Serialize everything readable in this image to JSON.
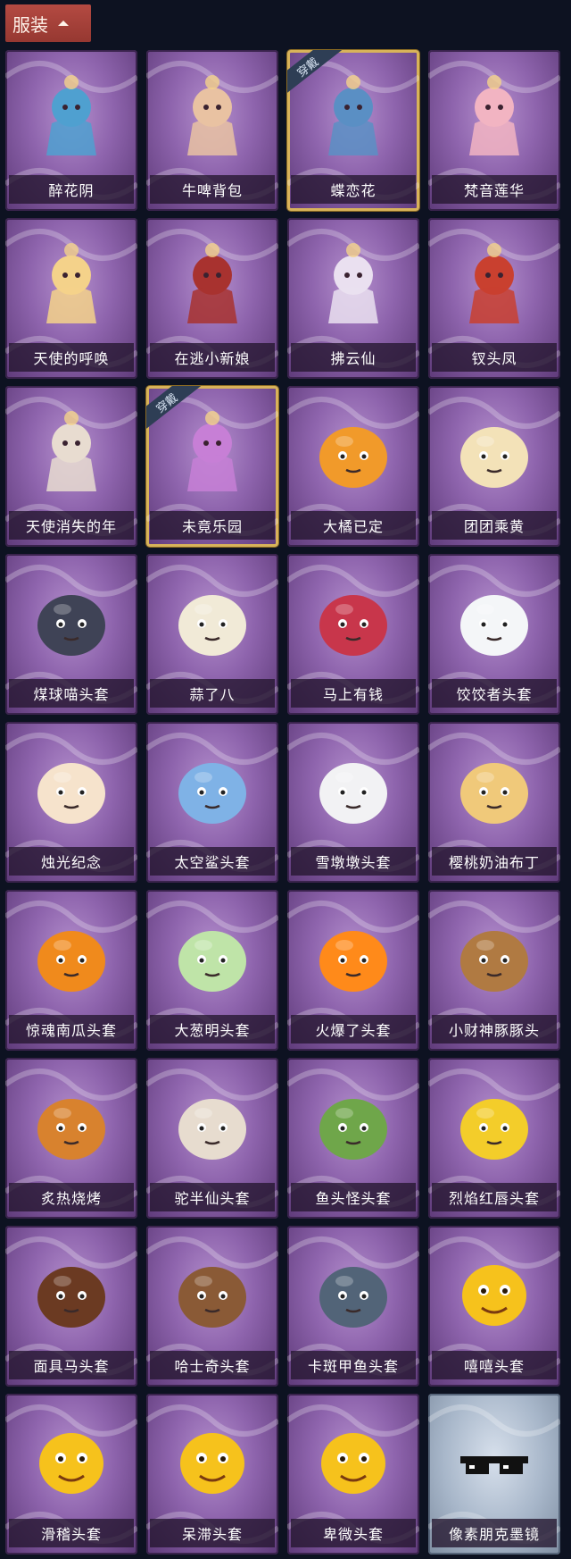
{
  "header": {
    "title": "服装"
  },
  "badge_label": "穿戴",
  "items": [
    {
      "name": "醉花阴",
      "art": "blue-floral-pendant-icon",
      "color": "#4fa0d0"
    },
    {
      "name": "牛啤背包",
      "art": "cow-beer-barrel-backpack-icon",
      "color": "#e9c2a2"
    },
    {
      "name": "蝶恋花",
      "art": "butterfly-bell-ornament-icon",
      "color": "#5a8fc4",
      "equipped": true
    },
    {
      "name": "梵音莲华",
      "art": "lotus-girl-figure-icon",
      "color": "#f2b4c2"
    },
    {
      "name": "天使的呼唤",
      "art": "angel-girl-figure-icon",
      "color": "#f4d28a"
    },
    {
      "name": "在逃小新娘",
      "art": "red-veil-bride-icon",
      "color": "#a8322f"
    },
    {
      "name": "拂云仙",
      "art": "cloud-fairy-charm-icon",
      "color": "#eae0f0"
    },
    {
      "name": "钗头凤",
      "art": "phoenix-crown-figure-icon",
      "color": "#c9402f"
    },
    {
      "name": "天使消失的年",
      "art": "veiled-angel-figure-icon",
      "color": "#e8dcd0"
    },
    {
      "name": "未竟乐园",
      "art": "candy-girl-figure-icon",
      "color": "#c77fd6",
      "equipped": true
    },
    {
      "name": "大橘已定",
      "art": "orange-slice-head-icon",
      "color": "#f19a2a"
    },
    {
      "name": "团团乘黄",
      "art": "fluffy-beast-head-icon",
      "color": "#f3e2b8"
    },
    {
      "name": "煤球喵头套",
      "art": "black-cat-head-icon",
      "color": "#3f4356"
    },
    {
      "name": "蒜了八",
      "art": "garlic-head-icon",
      "color": "#f1ead7"
    },
    {
      "name": "马上有钱",
      "art": "red-horse-head-icon",
      "color": "#c8364b"
    },
    {
      "name": "饺饺者头套",
      "art": "dumpling-head-icon",
      "color": "#f4f6f8"
    },
    {
      "name": "烛光纪念",
      "art": "candle-head-icon",
      "color": "#f6e3cc"
    },
    {
      "name": "太空鲨头套",
      "art": "space-shark-head-icon",
      "color": "#7fb2e6"
    },
    {
      "name": "雪墩墩头套",
      "art": "snowman-reindeer-head-icon",
      "color": "#f2f2f4"
    },
    {
      "name": "樱桃奶油布丁",
      "art": "cherry-pudding-head-icon",
      "color": "#f0c97a"
    },
    {
      "name": "惊魂南瓜头套",
      "art": "pumpkin-head-icon",
      "color": "#f08a1c"
    },
    {
      "name": "大葱明头套",
      "art": "green-onion-head-icon",
      "color": "#bfe4a8"
    },
    {
      "name": "火爆了头套",
      "art": "fire-head-icon",
      "color": "#ff8a1a"
    },
    {
      "name": "小财神豚豚头",
      "art": "capybara-god-of-wealth-head-icon",
      "color": "#b07a42"
    },
    {
      "name": "炙热烧烤",
      "art": "grilled-meat-head-icon",
      "color": "#d8822e"
    },
    {
      "name": "驼半仙头套",
      "art": "alpaca-sunglasses-head-icon",
      "color": "#e7dccf"
    },
    {
      "name": "鱼头怪头套",
      "art": "green-fish-head-icon",
      "color": "#6fa64a"
    },
    {
      "name": "烈焰红唇头套",
      "art": "yellow-mouse-sunglasses-head-icon",
      "color": "#f3cd2a"
    },
    {
      "name": "面具马头套",
      "art": "brown-horse-mask-icon",
      "color": "#6b3a22"
    },
    {
      "name": "哈士奇头套",
      "art": "husky-sunglasses-head-icon",
      "color": "#8a5a36"
    },
    {
      "name": "卡斑甲鱼头套",
      "art": "spotted-fish-head-icon",
      "color": "#526478"
    },
    {
      "name": "嘻嘻头套",
      "art": "grinning-emoji-head-icon",
      "color": "#f6c21c"
    },
    {
      "name": "滑稽头套",
      "art": "smirk-emoji-head-icon",
      "color": "#f6c21c"
    },
    {
      "name": "呆滞头套",
      "art": "dazed-emoji-head-icon",
      "color": "#f6c21c"
    },
    {
      "name": "卑微头套",
      "art": "humble-emoji-head-icon",
      "color": "#f6c21c"
    },
    {
      "name": "像素朋克墨镜",
      "art": "pixel-sunglasses-icon",
      "color": "#111111",
      "tier": "silver"
    }
  ]
}
